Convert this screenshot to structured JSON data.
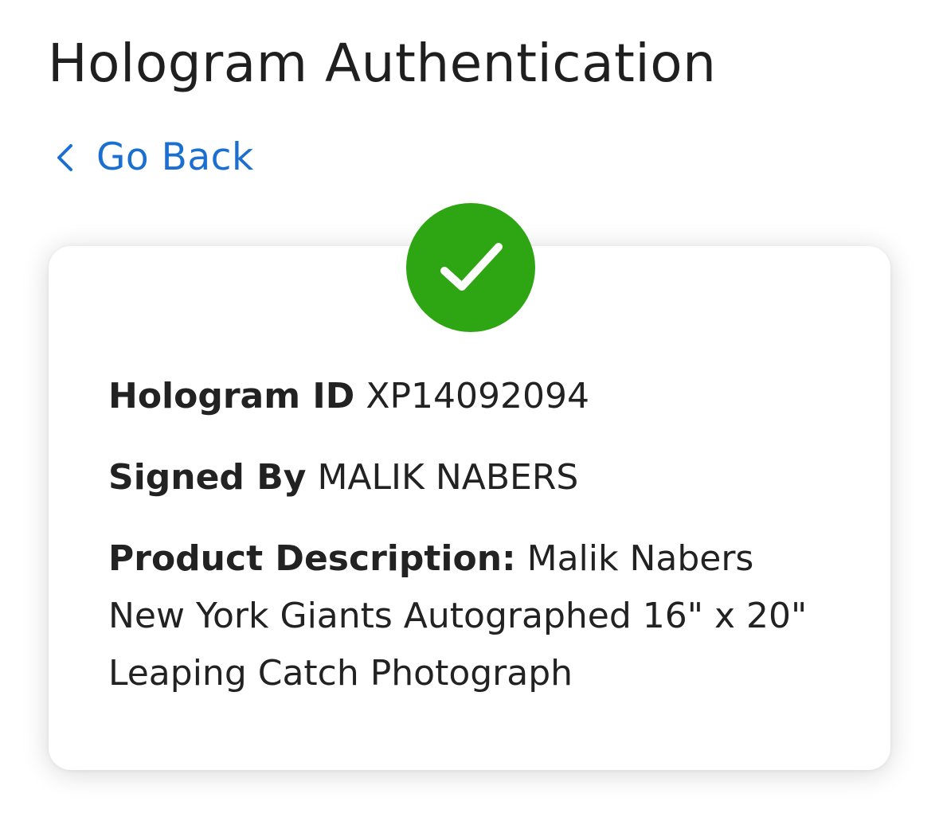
{
  "header": {
    "title": "Hologram Authentication"
  },
  "nav": {
    "back_label": "Go Back",
    "back_icon": "chevron-left-icon"
  },
  "status": {
    "icon": "checkmark-icon",
    "color": "#2ea513"
  },
  "details": {
    "hologram_id_label": "Hologram ID",
    "hologram_id_value": "XP14092094",
    "signed_by_label": "Signed By",
    "signed_by_value": "MALIK NABERS",
    "product_description_label": "Product Description:",
    "product_description_lines": [
      "Malik Nabers",
      "New York Giants Autographed 16\" x 20\"",
      "Leaping Catch Photograph"
    ]
  },
  "colors": {
    "link": "#1b6fd0",
    "text": "#202020",
    "success": "#2ea513"
  }
}
